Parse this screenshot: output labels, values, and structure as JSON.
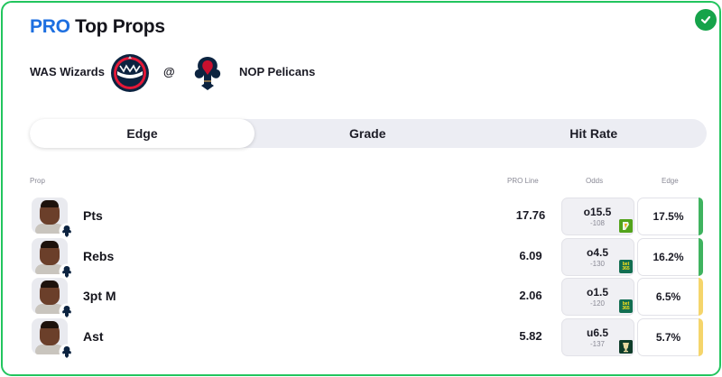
{
  "header": {
    "title_pro": "PRO",
    "title_rest": " Top Props",
    "verified_icon": "check-circle-icon"
  },
  "matchup": {
    "away_team": "WAS Wizards",
    "away_logo": "wizards-logo",
    "separator": "@",
    "home_team": "NOP Pelicans",
    "home_logo": "pelicans-logo"
  },
  "tabs": [
    {
      "label": "Edge",
      "active": true
    },
    {
      "label": "Grade",
      "active": false
    },
    {
      "label": "Hit Rate",
      "active": false
    }
  ],
  "table": {
    "headers": {
      "prop": "Prop",
      "pro_line": "PRO Line",
      "odds": "Odds",
      "edge": "Edge"
    },
    "rows": [
      {
        "stat": "Pts",
        "pro_line": "17.76",
        "odds_line": "o15.5",
        "odds_price": "-108",
        "book": "draftkings",
        "edge": "17.5%",
        "edge_color": "#3fb35f"
      },
      {
        "stat": "Rebs",
        "pro_line": "6.09",
        "odds_line": "o4.5",
        "odds_price": "-130",
        "book": "bet365",
        "edge": "16.2%",
        "edge_color": "#3fb35f"
      },
      {
        "stat": "3pt M",
        "pro_line": "2.06",
        "odds_line": "o1.5",
        "odds_price": "-120",
        "book": "bet365",
        "edge": "6.5%",
        "edge_color": "#f5d56b"
      },
      {
        "stat": "Ast",
        "pro_line": "5.82",
        "odds_line": "u6.5",
        "odds_price": "-137",
        "book": "other-book",
        "edge": "5.7%",
        "edge_color": "#f5d56b"
      }
    ]
  },
  "book_labels": {
    "bet365": "bet 365"
  },
  "colors": {
    "accent": "#1d6fe0",
    "border": "#22c55e",
    "edge_high": "#3fb35f",
    "edge_mid": "#f5d56b"
  }
}
